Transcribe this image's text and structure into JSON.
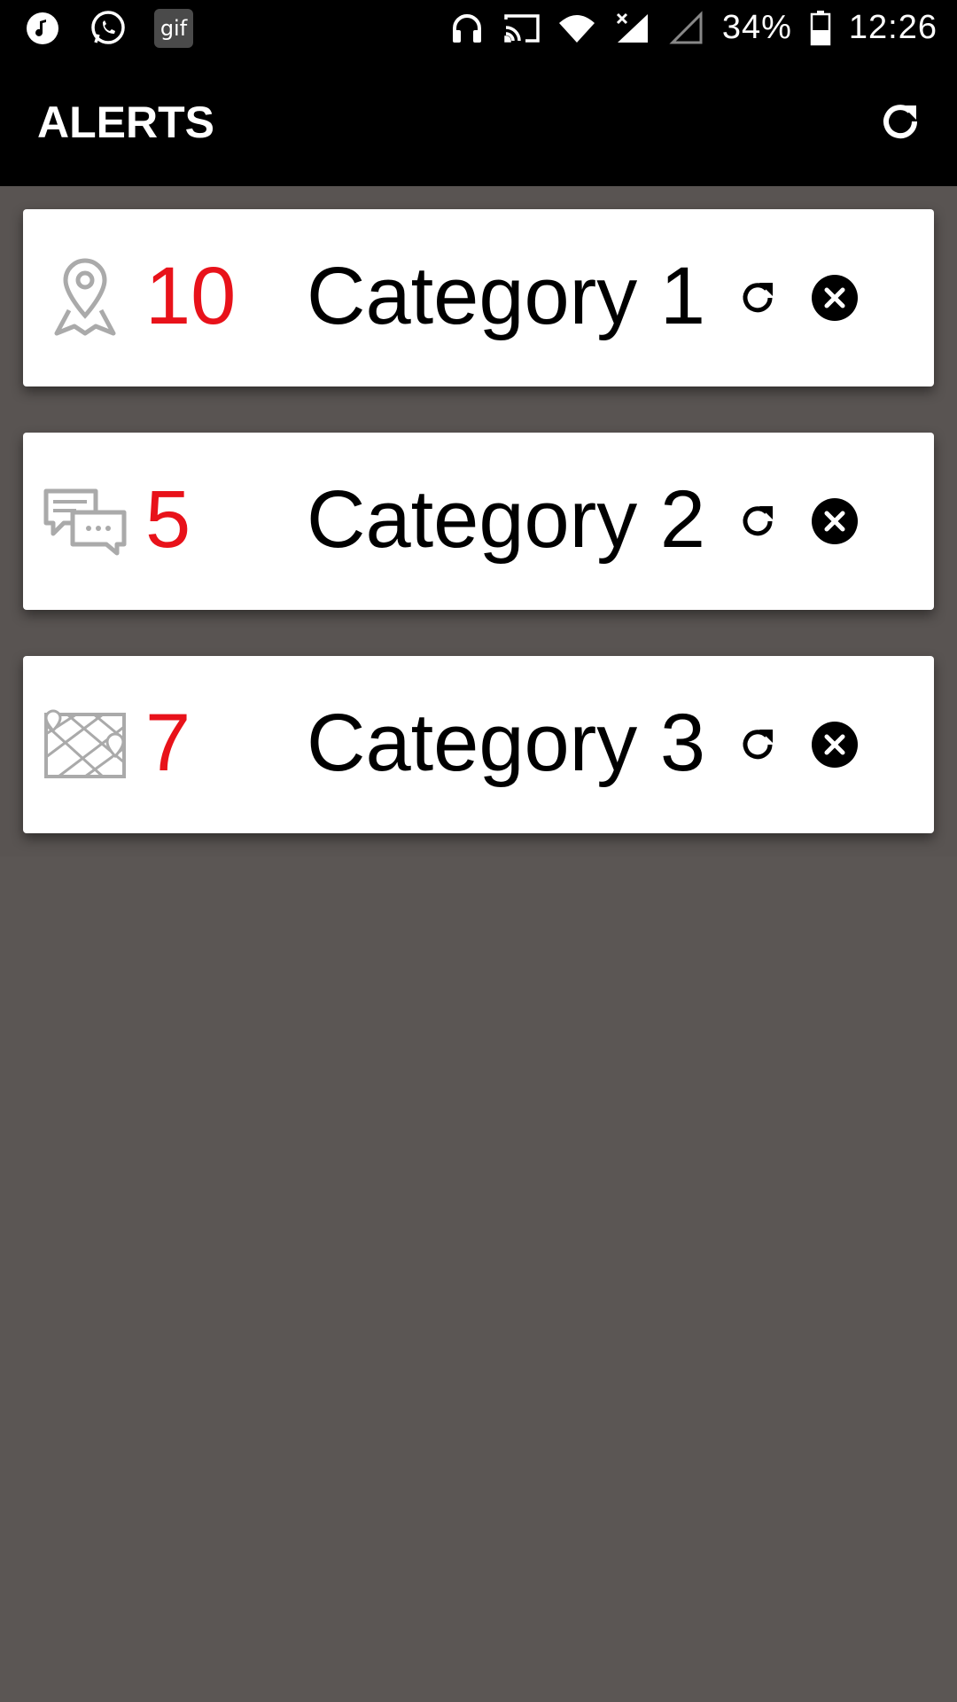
{
  "status_bar": {
    "icons_left": [
      "music-note-icon",
      "whatsapp-icon",
      "gif-icon"
    ],
    "gif_label": "gif",
    "icons_right": [
      "headphones-icon",
      "cast-icon",
      "wifi-icon",
      "signal-icon",
      "signal-empty-icon",
      "battery-icon"
    ],
    "battery_percent": "34%",
    "time": "12:26"
  },
  "app_bar": {
    "title": "ALERTS",
    "refresh_icon": "refresh-icon"
  },
  "alerts": [
    {
      "count": "10",
      "title": "Category 1",
      "icon": "map-pin-icon"
    },
    {
      "count": "5",
      "title": "Category 2",
      "icon": "chat-bubbles-icon"
    },
    {
      "count": "7",
      "title": "Category 3",
      "icon": "map-grid-icon"
    }
  ],
  "colors": {
    "count": "#e8121a",
    "app_bar": "#000000",
    "background": "#5b5654",
    "card": "#ffffff"
  }
}
